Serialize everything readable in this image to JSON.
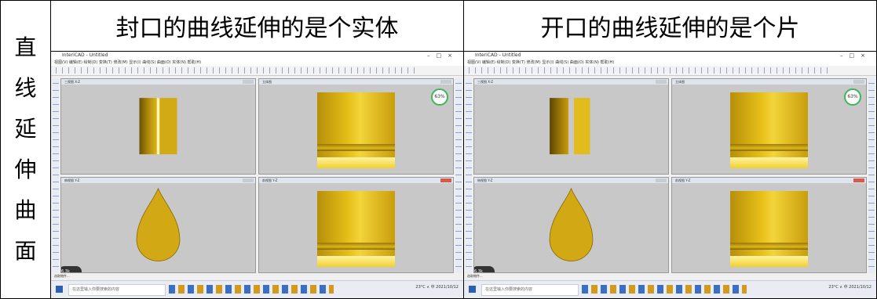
{
  "table": {
    "row_header_chars": [
      "直",
      "线",
      "延",
      "伸",
      "曲",
      "面"
    ],
    "col1_header": "封口的曲线延伸的是个实体",
    "col2_header": "开口的曲线延伸的是个片"
  },
  "screens": [
    {
      "window_title": "InteriCAD - Untitled",
      "menu": "视图(V)  编辑(E)  绘制(D)  变换(T)  修改(M)  显示(I)  曲线(S)  曲面(O)  实体(N)  帮助(H)",
      "viewport_titles": [
        "三视图 X-Z",
        "立体图",
        "俯视图 Y-Z",
        "前视图 Y-Z"
      ],
      "badge": "63%",
      "speed": "6.3k",
      "status": "选取物件...",
      "taskbar_search": "在这里输入你要搜索的内容",
      "tray": "23°C ∧ 中 2021/10/12"
    },
    {
      "window_title": "InteriCAD - Untitled",
      "menu": "视图(V)  编辑(E)  绘制(D)  变换(T)  修改(M)  显示(I)  曲线(S)  曲面(O)  实体(N)  帮助(H)",
      "viewport_titles": [
        "三视图 X-Z",
        "立体图",
        "俯视图 Y-Z",
        "前视图 Y-Z"
      ],
      "badge": "63%",
      "speed": "6.3k",
      "status": "选取物件...",
      "taskbar_search": "在这里输入你要搜索的内容",
      "tray": "23°C ∧ 中 2021/10/12"
    }
  ],
  "colors": {
    "gold": "#e6bf19",
    "viewport_bg": "#c8c8c8"
  }
}
